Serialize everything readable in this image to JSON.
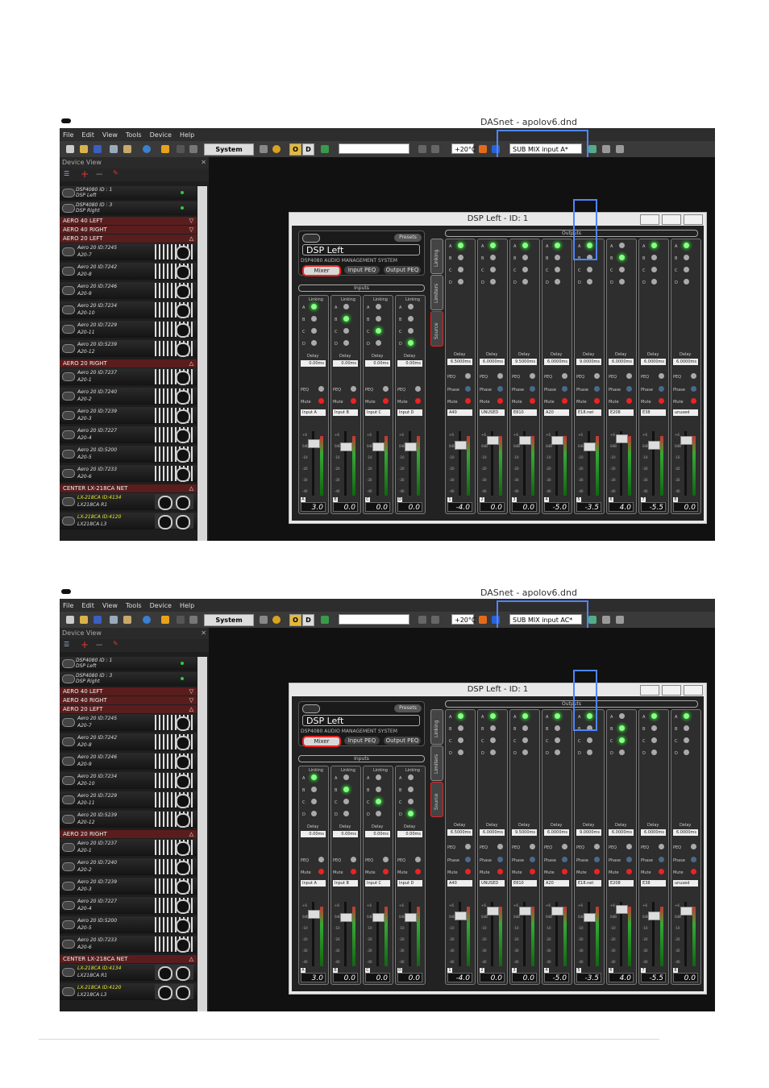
{
  "app_title": "DASnet - apolov6.dnd",
  "menu": [
    "File",
    "Edit",
    "View",
    "Tools",
    "Device",
    "Help"
  ],
  "toolbar": {
    "system_mute": "System MUTE",
    "o_button": "O",
    "d_button": "D",
    "temperature": "+20°C"
  },
  "screenshots": [
    {
      "combo_value": "SUB MIX input A*",
      "outputs_active": [
        [
          "A"
        ],
        [
          "A"
        ],
        [
          "A"
        ],
        [
          "A"
        ],
        [
          "A"
        ],
        [
          "B"
        ],
        [
          "A"
        ],
        [
          "A"
        ]
      ]
    },
    {
      "combo_value": "SUB MIX input AC*",
      "outputs_active": [
        [
          "A"
        ],
        [
          "A"
        ],
        [
          "A"
        ],
        [
          "A"
        ],
        [
          "A"
        ],
        [
          "B",
          "C"
        ],
        [
          "A"
        ],
        [
          "A"
        ]
      ]
    }
  ],
  "device_view": {
    "title": "Device View",
    "dsp_devices": [
      {
        "name": "DSP4080 ID : 1",
        "label": "DSP Left"
      },
      {
        "name": "DSP4080 ID : 3",
        "label": "DSP Right"
      }
    ],
    "groups": [
      {
        "name": "AERO 40 LEFT",
        "arrow": "▽",
        "speakers": []
      },
      {
        "name": "AERO 40 RIGHT",
        "arrow": "▽",
        "speakers": []
      },
      {
        "name": "AERO 20 LEFT",
        "arrow": "△",
        "speakers": [
          {
            "id": "Aero 20  ID:7245",
            "label": "A20-7"
          },
          {
            "id": "Aero 20  ID:7242",
            "label": "A20-8"
          },
          {
            "id": "Aero 20  ID:7246",
            "label": "A20-9"
          },
          {
            "id": "Aero 20  ID:7234",
            "label": "A20-10"
          },
          {
            "id": "Aero 20  ID:7229",
            "label": "A20-11"
          },
          {
            "id": "Aero 20  ID:5239",
            "label": "A20-12"
          }
        ]
      },
      {
        "name": "AERO 20 RIGHT",
        "arrow": "△",
        "speakers": [
          {
            "id": "Aero 20  ID:7237",
            "label": "A20-1"
          },
          {
            "id": "Aero 20  ID:7240",
            "label": "A20-2"
          },
          {
            "id": "Aero 20  ID:7239",
            "label": "A20-3"
          },
          {
            "id": "Aero 20  ID:7227",
            "label": "A20-4"
          },
          {
            "id": "Aero 20  ID:5200",
            "label": "A20-5"
          },
          {
            "id": "Aero 20  ID:7233",
            "label": "A20-6"
          }
        ]
      },
      {
        "name": "CENTER LX-218CA NET",
        "arrow": "△",
        "lx": true,
        "speakers": [
          {
            "id": "LX-218CA  ID:4134",
            "label": "LX218CA R1"
          },
          {
            "id": "LX-218CA  ID:4120",
            "label": "LX218CA L3"
          }
        ]
      }
    ]
  },
  "dsp_window": {
    "title": "DSP Left - ID: 1",
    "device_name": "DSP Left",
    "subtitle": "DSP4080  AUDIO MANAGEMENT SYSTEM",
    "presets": "Presets",
    "buttons": [
      "Mixer",
      "Input PEQ",
      "Output PEQ"
    ],
    "inputs_header": "Inputs",
    "outputs_header": "Outputs",
    "side_tabs": [
      "Linking",
      "Limiters",
      "Source"
    ],
    "labels": {
      "linking": "Linking",
      "delay": "Delay",
      "peq": "PEQ",
      "mute": "Mute",
      "phase": "Phase"
    },
    "routing_letters": [
      "A",
      "B",
      "C",
      "D"
    ],
    "inputs": [
      {
        "name": "Input A",
        "delay": "0.00ms",
        "gain": "3.0",
        "num": "A",
        "active": "A"
      },
      {
        "name": "Input B",
        "delay": "0.00ms",
        "gain": "0.0",
        "num": "B",
        "active": "B"
      },
      {
        "name": "Input C",
        "delay": "0.00ms",
        "gain": "0.0",
        "num": "C",
        "active": "C"
      },
      {
        "name": "Input D",
        "delay": "0.00ms",
        "gain": "0.0",
        "num": "D",
        "active": "D"
      }
    ],
    "outputs": [
      {
        "name": "A40",
        "delay": "6.5000ms",
        "gain": "-4.0",
        "num": "1"
      },
      {
        "name": "UNUSED",
        "delay": "6.0000ms",
        "gain": "0.0",
        "num": "2"
      },
      {
        "name": "E810",
        "delay": "9.5000ms",
        "gain": "0.0",
        "num": "3"
      },
      {
        "name": "A20",
        "delay": "6.0000ms",
        "gain": "-5.0",
        "num": "4"
      },
      {
        "name": "E18.net",
        "delay": "9.0000ms",
        "gain": "-3.5",
        "num": "5"
      },
      {
        "name": "E208",
        "delay": "6.0000ms",
        "gain": "4.0",
        "num": "6"
      },
      {
        "name": "E38",
        "delay": "6.0000ms",
        "gain": "-5.5",
        "num": "7"
      },
      {
        "name": "unused",
        "delay": "6.0000ms",
        "gain": "0.0",
        "num": "8"
      }
    ],
    "fader_scale": [
      "+6",
      "0dB",
      "-10",
      "-20",
      "-30",
      "-40"
    ]
  }
}
